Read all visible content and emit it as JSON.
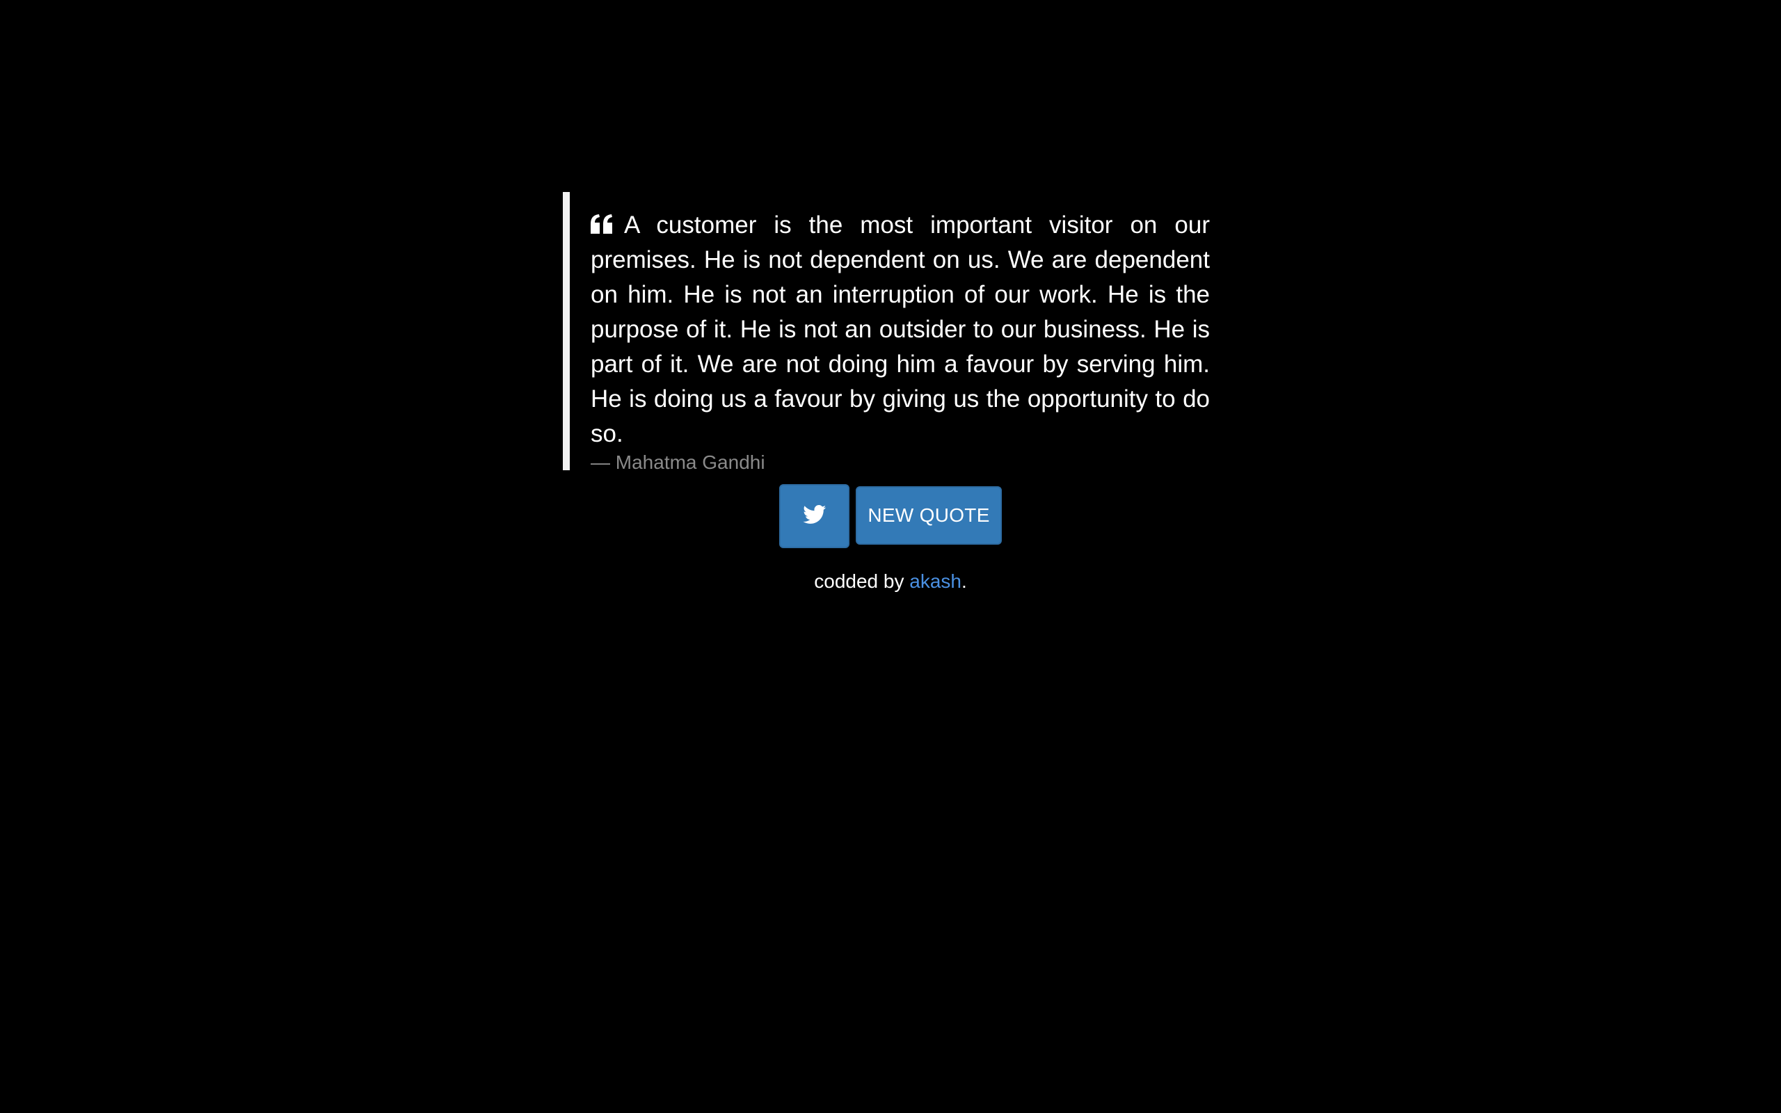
{
  "quote": {
    "icon": "quote-left-icon",
    "text": "A customer is the most important visitor on our premises. He is not dependent on us. We are dependent on him. He is not an interruption of our work. He is the purpose of it. He is not an outsider to our business. He is part of it. We are not doing him a favour by serving him. He is doing us a favour by giving us the opportunity to do so.",
    "author": "— Mahatma Gandhi"
  },
  "actions": {
    "tweet_icon": "twitter-icon",
    "new_quote_label": "NEW QUOTE"
  },
  "footer": {
    "prefix": "codded by ",
    "author_link": "akash",
    "suffix": "."
  },
  "colors": {
    "background": "#000000",
    "button": "#337ab7",
    "link": "#4a90e2",
    "author_text": "#8a8a8a"
  }
}
